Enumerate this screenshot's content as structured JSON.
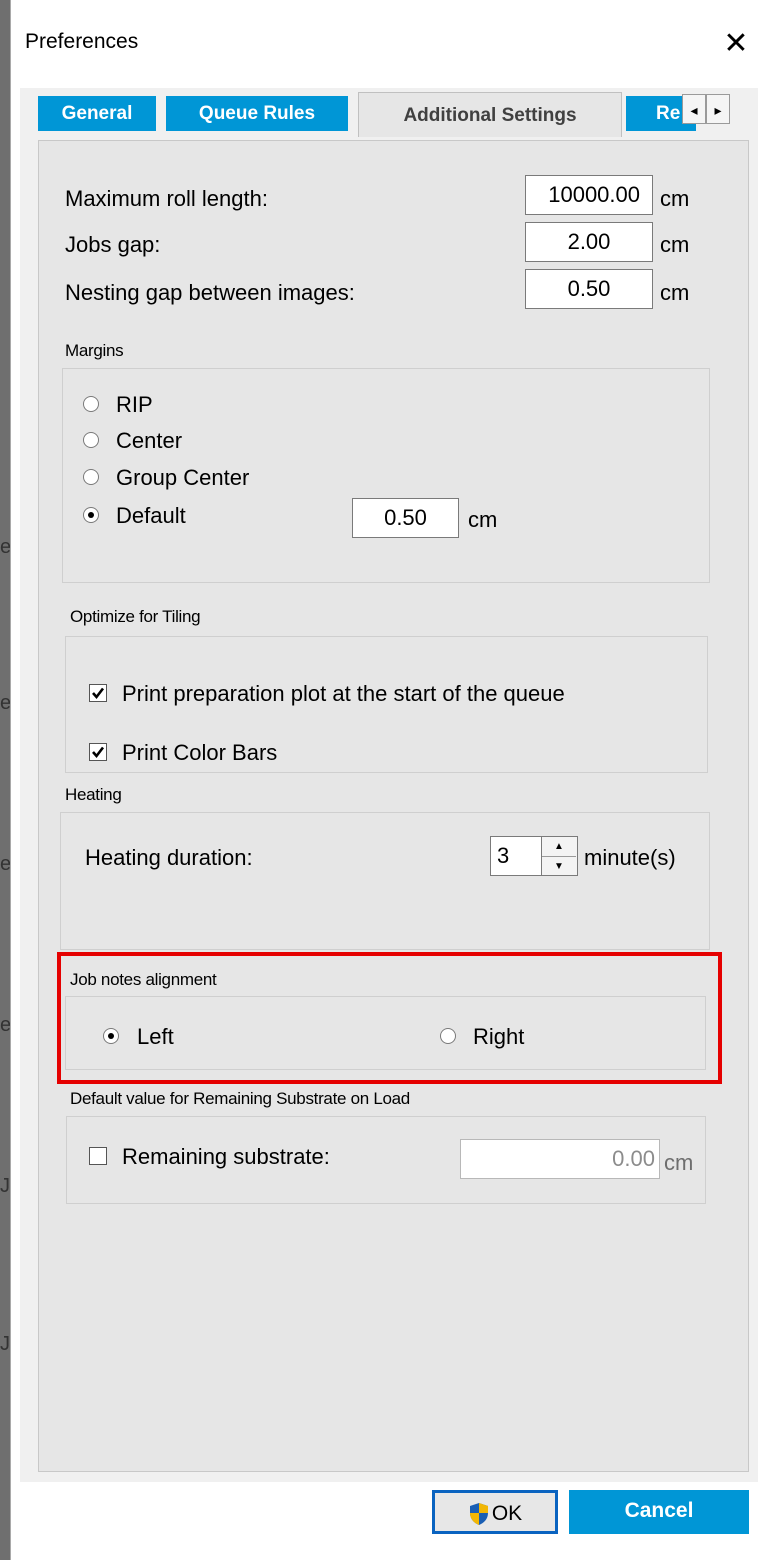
{
  "window": {
    "title": "Preferences"
  },
  "tabs": [
    {
      "label": "General",
      "active": false
    },
    {
      "label": "Queue Rules",
      "active": false
    },
    {
      "label": "Additional Settings",
      "active": true
    },
    {
      "label": "Re",
      "active": false
    }
  ],
  "background_letters": [
    "e",
    "e",
    "e",
    "e",
    "J",
    "J"
  ],
  "general": {
    "max_roll_length": {
      "label": "Maximum roll length:",
      "value": "10000.00",
      "unit": "cm"
    },
    "jobs_gap": {
      "label": "Jobs gap:",
      "value": "2.00",
      "unit": "cm"
    },
    "nesting_gap": {
      "label": "Nesting gap between images:",
      "value": "0.50",
      "unit": "cm"
    }
  },
  "margins": {
    "title": "Margins",
    "options": [
      {
        "label": "RIP",
        "selected": false
      },
      {
        "label": "Center",
        "selected": false
      },
      {
        "label": "Group Center",
        "selected": false
      },
      {
        "label": "Default",
        "selected": true
      }
    ],
    "default_value": "0.50",
    "unit": "cm"
  },
  "tiling": {
    "title": "Optimize for Tiling",
    "options": [
      {
        "label": "Print preparation plot at the start of the queue",
        "checked": true
      },
      {
        "label": "Print Color Bars",
        "checked": true
      }
    ]
  },
  "heating": {
    "title": "Heating",
    "label": "Heating duration:",
    "value": "3",
    "unit": "minute(s)"
  },
  "job_notes": {
    "title": "Job notes alignment",
    "options": [
      {
        "label": "Left",
        "selected": true
      },
      {
        "label": "Right",
        "selected": false
      }
    ],
    "highlight_color": "#e50000"
  },
  "remaining_substrate": {
    "title": "Default value for Remaining Substrate on Load",
    "label": "Remaining substrate:",
    "checked": false,
    "value": "0.00",
    "unit": "cm"
  },
  "buttons": {
    "ok": "OK",
    "cancel": "Cancel"
  },
  "colors": {
    "accent": "#0096d6",
    "panel": "#e6e6e6",
    "focus": "#0a63c0"
  }
}
